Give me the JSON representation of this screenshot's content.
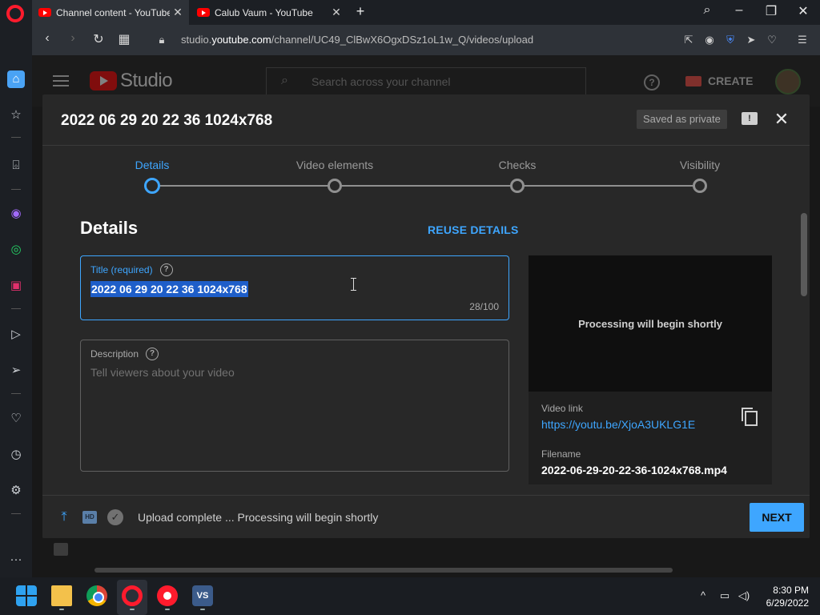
{
  "browser": {
    "tabs": [
      {
        "label": "Channel content - YouTube",
        "active": true
      },
      {
        "label": "Calub Vaum - YouTube",
        "active": false
      }
    ],
    "url_prefix": "studio.",
    "url_host": "youtube.com",
    "url_path": "/channel/UC49_ClBwX6OgxDSz1oL1w_Q/videos/upload"
  },
  "yt": {
    "brand": "Studio",
    "search_placeholder": "Search across your channel",
    "create_label": "CREATE"
  },
  "dialog": {
    "title": "2022 06 29 20 22 36 1024x768",
    "saved_chip": "Saved as private",
    "steps": [
      "Details",
      "Video elements",
      "Checks",
      "Visibility"
    ],
    "section_heading": "Details",
    "reuse_label": "REUSE DETAILS",
    "title_field": {
      "label": "Title (required)",
      "value": "2022 06 29 20 22 36 1024x768",
      "counter": "28/100"
    },
    "description_field": {
      "label": "Description",
      "placeholder": "Tell viewers about your video"
    },
    "preview": {
      "processing_text": "Processing will begin shortly",
      "video_link_label": "Video link",
      "video_link": "https://youtu.be/XjoA3UKLG1E",
      "filename_label": "Filename",
      "filename": "2022-06-29-20-22-36-1024x768.mp4"
    },
    "footer": {
      "status": "Upload complete ... Processing will begin shortly",
      "next_label": "NEXT"
    }
  },
  "taskbar": {
    "time": "8:30 PM",
    "date": "6/29/2022"
  },
  "colors": {
    "accent": "#3ea6ff",
    "brand_red": "#ff0000",
    "dialog_bg": "#282828"
  }
}
